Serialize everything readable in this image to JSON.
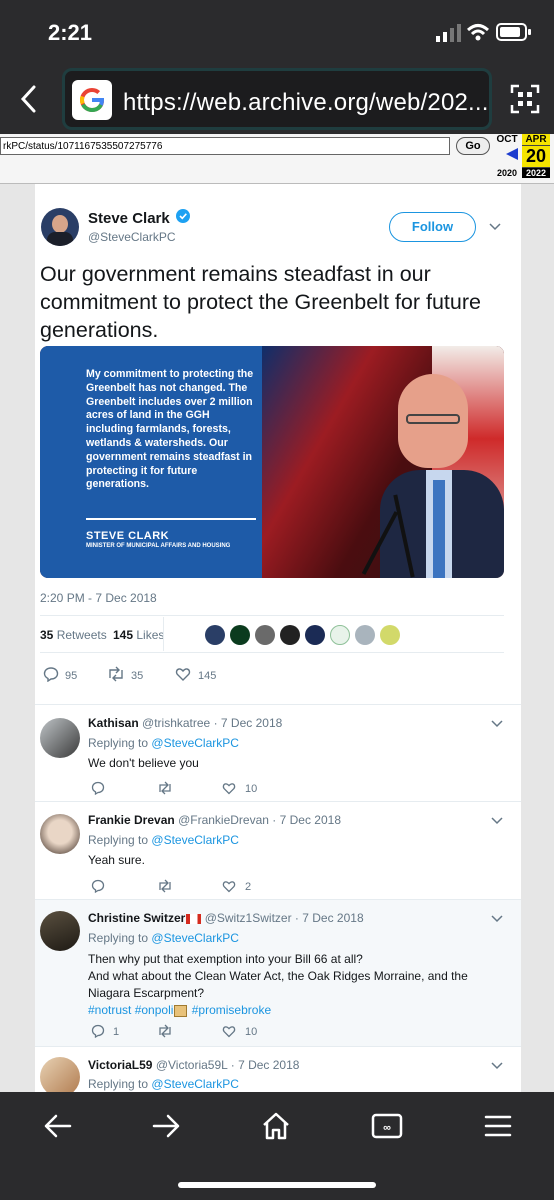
{
  "status_bar": {
    "time": "2:21"
  },
  "browser": {
    "url": "https://web.archive.org/web/202..."
  },
  "wayback": {
    "url_value": "rkPC/status/1071167535507275776",
    "go_label": "Go",
    "month_prev": "OCT",
    "month_curr": "APR",
    "day": "20",
    "year_prev": "2020",
    "year_curr": "2022"
  },
  "tweet": {
    "author_name": "Steve Clark",
    "author_handle": "@SteveClarkPC",
    "follow_label": "Follow",
    "text": "Our government remains steadfast in our commitment to protect the Greenbelt for future generations.",
    "image_text": "My commitment to protecting the Greenbelt has not changed. The Greenbelt includes over 2 million acres of land in the GGH including farmlands, forests, wetlands & watersheds. Our government remains steadfast in protecting it for future generations.",
    "image_signature_name": "STEVE CLARK",
    "image_signature_title": "MINISTER OF MUNICIPAL AFFAIRS AND HOUSING",
    "timestamp": "2:20 PM - 7 Dec 2018",
    "retweets_count": "35",
    "retweets_label": "Retweets",
    "likes_count": "145",
    "likes_label": "Likes",
    "reply_count": "95",
    "retweet_count": "35",
    "like_count": "145"
  },
  "replies": [
    {
      "name": "Kathisan",
      "handle": "@trishkatree",
      "date": "· 7 Dec 2018",
      "replying_prefix": "Replying to",
      "replying_to": "@SteveClarkPC",
      "text": "We don't believe you",
      "reply_count": "",
      "retweet_count": "",
      "like_count": "10"
    },
    {
      "name": "Frankie Drevan",
      "handle": "@FrankieDrevan",
      "date": "· 7 Dec 2018",
      "replying_prefix": "Replying to",
      "replying_to": "@SteveClarkPC",
      "text": "Yeah sure.",
      "reply_count": "",
      "retweet_count": "",
      "like_count": "2"
    },
    {
      "name": "Christine Switzer",
      "handle": "@Switz1Switzer",
      "date": "· 7 Dec 2018",
      "replying_prefix": "Replying to",
      "replying_to": "@SteveClarkPC",
      "text_line1": "Then why put that exemption into your Bill 66 at all?",
      "text_line2": "And what about the Clean Water Act, the Oak Ridges Morraine, and the Niagara Escarpment?",
      "tags_a": "#notrust #onpoli",
      "tags_b": "#promisebroke",
      "reply_count": "1",
      "retweet_count": "",
      "like_count": "10"
    },
    {
      "name": "VictoriaL59",
      "handle": "@Victoria59L",
      "date": "· 7 Dec 2018",
      "replying_prefix": "Replying to",
      "replying_to": "@SteveClarkPC"
    }
  ],
  "icons": [
    "back-icon",
    "google-icon",
    "qr-scan-icon",
    "verified-icon",
    "chevron-down-icon",
    "reply-icon",
    "retweet-icon",
    "like-icon",
    "nav-back-icon",
    "nav-forward-icon",
    "home-icon",
    "tabs-icon",
    "menu-icon"
  ],
  "colors": {
    "twitter_blue": "#1b95e0",
    "ontario_blue": "#1e5ba8",
    "browser_bg": "#2b2b2d",
    "wayback_yellow": "#f5e400"
  }
}
